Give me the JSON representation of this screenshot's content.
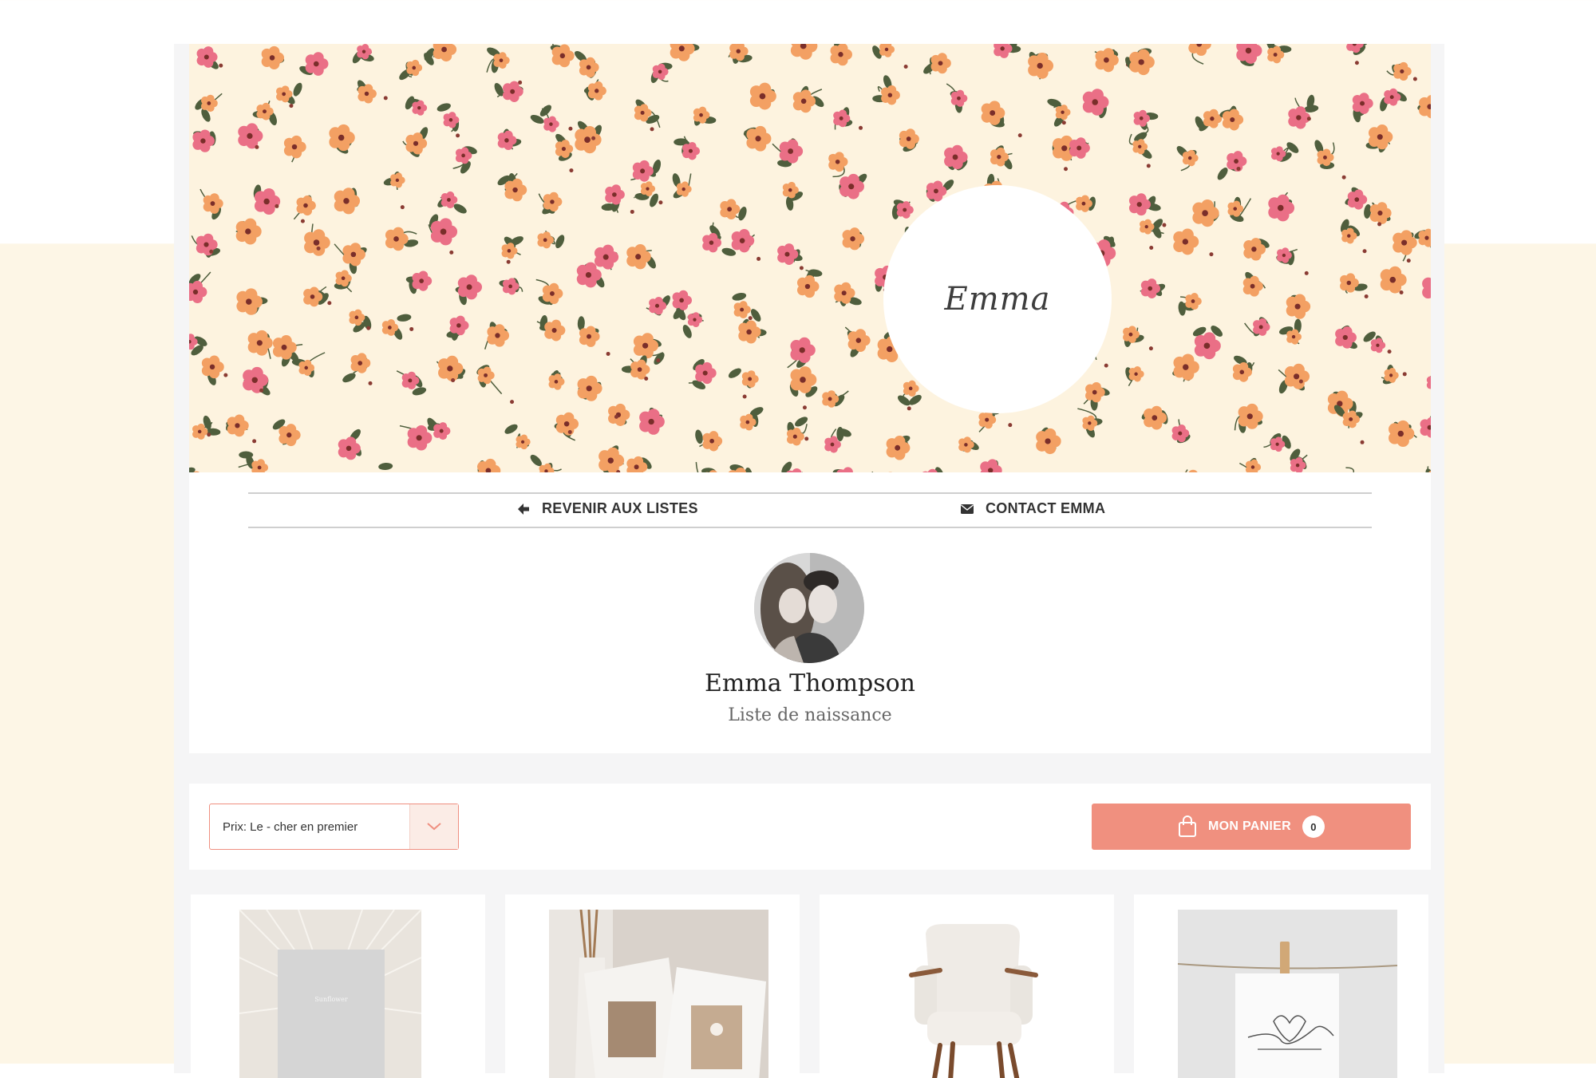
{
  "hero": {
    "name_script": "Emma",
    "colors": {
      "background": "#fdf3df",
      "orange": "#f3a063",
      "pink": "#ea6f86",
      "leaf": "#4f5e3d"
    }
  },
  "nav": {
    "back_label": "REVENIR AUX LISTES",
    "contact_label": "CONTACT EMMA"
  },
  "profile": {
    "name": "Emma Thompson",
    "list_type": "Liste de naissance"
  },
  "toolbar": {
    "sort_value": "Prix: Le - cher en premier",
    "cart_label": "MON PANIER",
    "cart_count": "0"
  },
  "products": [
    {
      "icon": "photo-frame"
    },
    {
      "icon": "photo-book"
    },
    {
      "icon": "armchair"
    },
    {
      "icon": "hand-drawing-card"
    }
  ],
  "colors": {
    "accent": "#f0907f",
    "page_bg": "#fdf6e6"
  }
}
